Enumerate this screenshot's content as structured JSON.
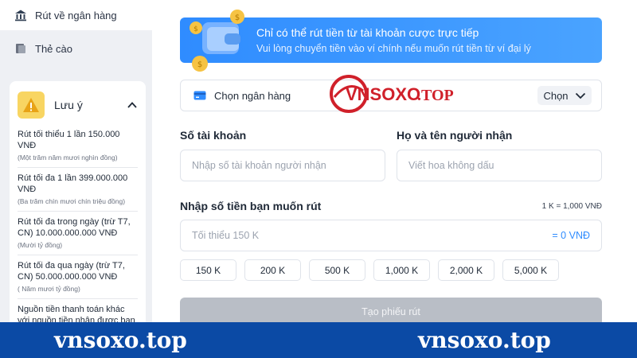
{
  "sidebar": {
    "nav": [
      {
        "label": "Rút về ngân hàng",
        "icon": "bank-icon"
      },
      {
        "label": "Thẻ cào",
        "icon": "card-icon"
      }
    ],
    "note": {
      "title": "Lưu ý",
      "icon": "warning-icon",
      "items": [
        {
          "main": "Rút tối thiểu 1 lần 150.000 VNĐ",
          "sub": "(Một trăm năm mươi nghìn đồng)"
        },
        {
          "main": "Rút tối đa 1 lần 399.000.000 VNĐ",
          "sub": "(Ba trăm chín mươi chín triệu đồng)"
        },
        {
          "main": "Rút tối đa trong ngày (trừ T7, CN) 10.000.000.000 VNĐ",
          "sub": "(Mười tỷ đồng)"
        },
        {
          "main": "Rút tối đa qua ngày (trừ T7, CN) 50.000.000.000 VNĐ",
          "sub": "( Năm mươi tỷ đồng)"
        },
        {
          "main": "Nguồn tiền thanh toán khác với nguồn tiền nhận được ban đầu",
          "sub": ""
        }
      ]
    }
  },
  "banner": {
    "line1": "Chỉ có thể rút tiền từ tài khoản cược trực tiếp",
    "line2": "Vui lòng chuyển tiền vào ví chính nếu muốn rút tiền từ ví đại lý"
  },
  "bank_select": {
    "label": "Chọn ngân hàng",
    "button": "Chọn"
  },
  "logo": {
    "text_main": "VNSOXO",
    "text_suffix": ".TOP"
  },
  "account": {
    "label": "Số tài khoản",
    "placeholder": "Nhập số tài khoản người nhận"
  },
  "recipient": {
    "label": "Họ và tên người nhận",
    "placeholder": "Viết hoa không dấu"
  },
  "amount": {
    "label": "Nhập số tiền bạn muốn rút",
    "rate": "1 K = 1,000 VNĐ",
    "placeholder": "Tối thiểu 150 K",
    "converted": "= 0 VNĐ"
  },
  "chips": [
    "150 K",
    "200 K",
    "500 K",
    "1,000 K",
    "2,000 K",
    "5,000 K"
  ],
  "submit": "Tạo phiếu rút",
  "footer": {
    "left": "vnsoxo.top",
    "right": "vnsoxo.top"
  },
  "colors": {
    "accent": "#2f8cff",
    "footer": "#0b4aa5",
    "logo_red": "#d0202a"
  }
}
